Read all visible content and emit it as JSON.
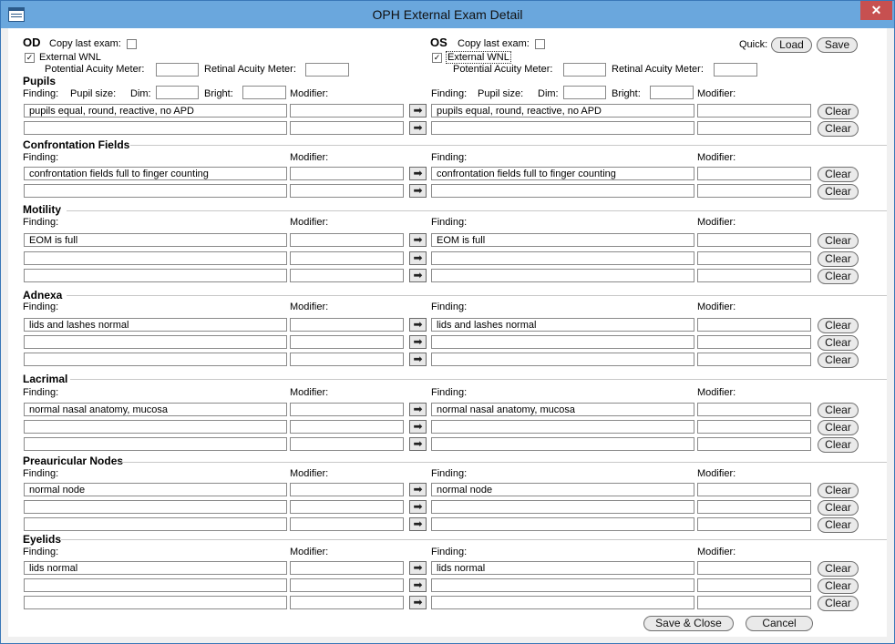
{
  "window": {
    "title": "OPH External Exam Detail",
    "close_glyph": "✕"
  },
  "od": {
    "label": "OD",
    "copy_last_exam": "Copy last exam:",
    "external_wnl": "External WNL",
    "external_wnl_checked": true,
    "potential_acuity": "Potential Acuity Meter:",
    "retinal_acuity": "Retinal Acuity Meter:"
  },
  "os": {
    "label": "OS",
    "copy_last_exam": "Copy last exam:",
    "external_wnl": "External WNL",
    "external_wnl_checked": true,
    "potential_acuity": "Potential Acuity Meter:",
    "retinal_acuity": "Retinal Acuity Meter:"
  },
  "quick": {
    "label": "Quick:",
    "load": "Load",
    "save": "Save"
  },
  "labels": {
    "finding": "Finding:",
    "modifier": "Modifier:",
    "pupil_size": "Pupil size:",
    "dim": "Dim:",
    "bright": "Bright:",
    "clear": "Clear"
  },
  "sections": [
    {
      "key": "pupils",
      "title": "Pupils",
      "rows": [
        "pupils equal, round, reactive, no APD",
        ""
      ]
    },
    {
      "key": "confrontation",
      "title": "Confrontation Fields",
      "rows": [
        "confrontation fields full to finger counting",
        ""
      ]
    },
    {
      "key": "motility",
      "title": "Motility",
      "rows": [
        "EOM is full",
        "",
        ""
      ]
    },
    {
      "key": "adnexa",
      "title": "Adnexa",
      "rows": [
        "lids and lashes normal",
        "",
        ""
      ]
    },
    {
      "key": "lacrimal",
      "title": "Lacrimal",
      "rows": [
        "normal nasal anatomy, mucosa",
        "",
        ""
      ]
    },
    {
      "key": "preauricular",
      "title": "Preauricular Nodes",
      "rows": [
        "normal node",
        "",
        ""
      ]
    },
    {
      "key": "eyelids",
      "title": "Eyelids",
      "rows": [
        "lids normal",
        "",
        ""
      ]
    }
  ],
  "footer": {
    "save_close": "Save & Close",
    "cancel": "Cancel"
  }
}
